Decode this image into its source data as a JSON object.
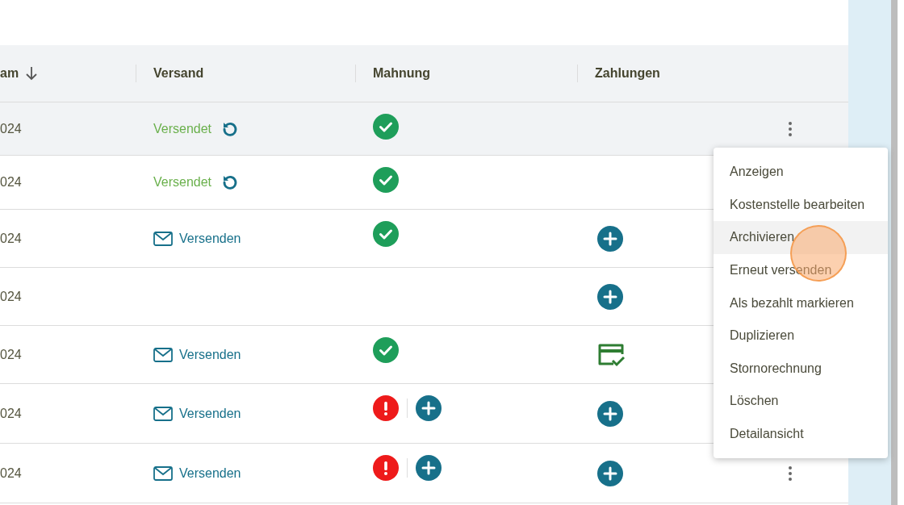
{
  "table": {
    "columns": [
      {
        "label": "am",
        "sort_descending": true
      },
      {
        "label": "Versand"
      },
      {
        "label": "Mahnung"
      },
      {
        "label": "Zahlungen"
      }
    ],
    "rows": [
      {
        "date": "024",
        "selected": true,
        "shipping": {
          "kind": "sent",
          "label": "Versendet"
        },
        "reminders": [
          {
            "kind": "ok"
          }
        ],
        "payment": {
          "kind": "none"
        },
        "actions_visible": true
      },
      {
        "date": "024",
        "selected": false,
        "shipping": {
          "kind": "sent",
          "label": "Versendet"
        },
        "reminders": [
          {
            "kind": "ok"
          }
        ],
        "payment": {
          "kind": "none"
        },
        "actions_visible": false
      },
      {
        "date": "024",
        "selected": false,
        "shipping": {
          "kind": "send",
          "label": "Versenden"
        },
        "reminders": [
          {
            "kind": "ok"
          }
        ],
        "payment": {
          "kind": "add"
        },
        "actions_visible": false
      },
      {
        "date": "024",
        "selected": false,
        "shipping": {
          "kind": "none"
        },
        "reminders": [],
        "payment": {
          "kind": "add"
        },
        "actions_visible": false
      },
      {
        "date": "024",
        "selected": false,
        "shipping": {
          "kind": "send",
          "label": "Versenden"
        },
        "reminders": [
          {
            "kind": "ok"
          }
        ],
        "payment": {
          "kind": "paid"
        },
        "actions_visible": false
      },
      {
        "date": "024",
        "selected": false,
        "shipping": {
          "kind": "send",
          "label": "Versenden"
        },
        "reminders": [
          {
            "kind": "overdue"
          },
          {
            "kind": "add"
          }
        ],
        "payment": {
          "kind": "add"
        },
        "actions_visible": false
      },
      {
        "date": "024",
        "selected": false,
        "shipping": {
          "kind": "send",
          "label": "Versenden"
        },
        "reminders": [
          {
            "kind": "overdue"
          },
          {
            "kind": "add"
          }
        ],
        "payment": {
          "kind": "add"
        },
        "actions_visible": true
      }
    ]
  },
  "context_menu": {
    "items": [
      {
        "label": "Anzeigen",
        "selected": false
      },
      {
        "label": "Kostenstelle bearbeiten",
        "selected": false
      },
      {
        "label": "Archivieren",
        "selected": true
      },
      {
        "label": "Erneut versenden",
        "selected": false
      },
      {
        "label": "Als bezahlt markieren",
        "selected": false
      },
      {
        "label": "Duplizieren",
        "selected": false
      },
      {
        "label": "Stornorechnung",
        "selected": false
      },
      {
        "label": "Löschen",
        "selected": false
      },
      {
        "label": "Detailansicht",
        "selected": false
      }
    ]
  },
  "click_indicator": {
    "visible": true
  }
}
